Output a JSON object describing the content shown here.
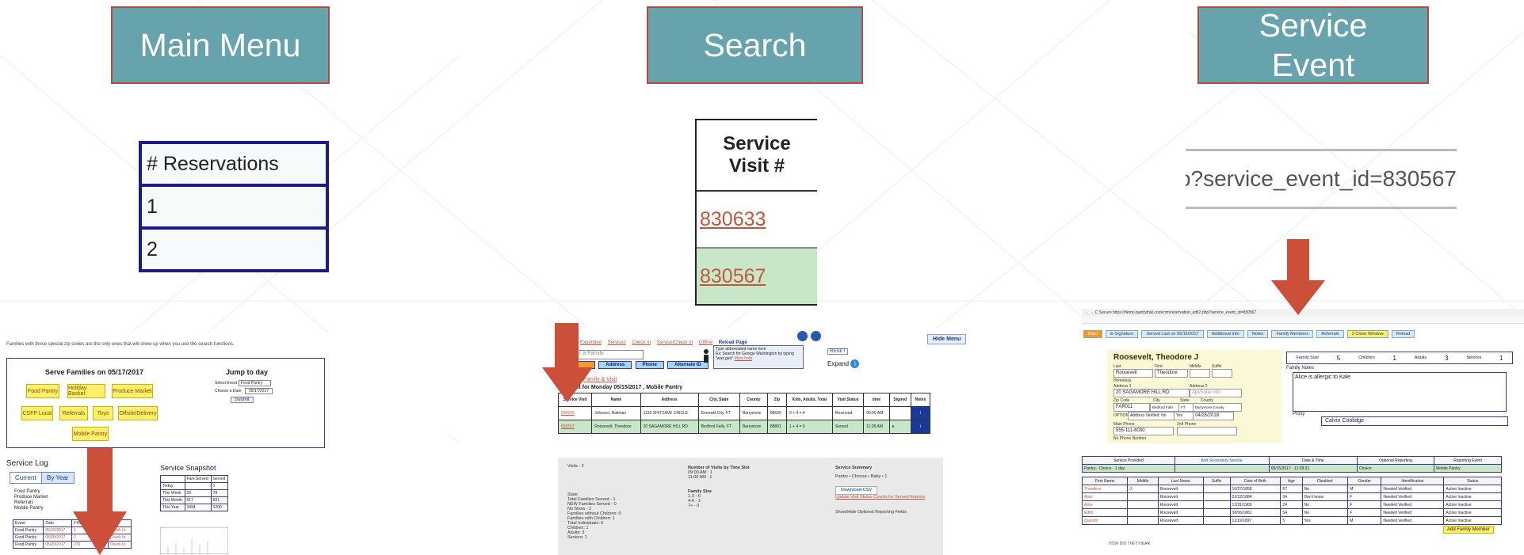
{
  "headers": {
    "main_menu": "Main Menu",
    "search": "Search",
    "service_event": "Service\nEvent"
  },
  "callouts": {
    "reservations": {
      "header": "# Reservations",
      "rows": [
        "1",
        "2"
      ]
    },
    "service_visit": {
      "header": "Service\nVisit #",
      "rows": [
        "830633",
        "830567"
      ]
    },
    "url_fragment": "o?service_event_id=830567"
  },
  "main_menu_screen": {
    "intro_text": "Families with these special zip codes are the only ones that will show up when you use the search functions.",
    "serve_title": "Serve Families on 05/17/2017",
    "jump_title": "Jump to day",
    "select_event_label": "Select Event",
    "select_event_value": "Food Pantry",
    "choose_date_label": "Choose a Date",
    "choose_date_value": "05/17/2017",
    "submit_label": "Submit",
    "event_buttons": [
      "Food Pantry",
      "Holiday Basket",
      "Produce Market",
      "CSFP Local",
      "Referrals",
      "Toys",
      "Offsite/Delivery",
      "Mobile Pantry"
    ],
    "service_log_title": "Service Log",
    "tabs": [
      "Current",
      "By Year"
    ],
    "legend_lines": [
      "Food Pantry",
      "Produce Market",
      "Referrals",
      "Mobile Pantry"
    ],
    "log_headers": [
      "Event",
      "Date",
      "# Reservations",
      ""
    ],
    "log_rows": [
      [
        "Food Pantry",
        "05/20/2017",
        "1",
        "Check In"
      ],
      [
        "Food Pantry",
        "05/20/2017",
        "2",
        "Check In"
      ],
      [
        "Food Pantry",
        "05/20/2017",
        "270",
        "Check In"
      ]
    ],
    "snapshot_title": "Service Snapshot",
    "snapshot_headers": [
      "",
      "Fam Served",
      "Served"
    ],
    "snapshot_rows": [
      [
        "Today",
        "",
        "1"
      ],
      [
        "This Week",
        "29",
        "78"
      ],
      [
        "This Month",
        "617",
        "691"
      ],
      [
        "This Year",
        "3494",
        "1200"
      ]
    ]
  },
  "search_screen": {
    "nav_links": [
      "Expanded",
      "Services",
      "Check In",
      "Service/Check In",
      "Offline"
    ],
    "reload_label": "Reload Page",
    "hide_menu_label": "Hide Menu",
    "search_placeholder": "r a Family",
    "search_tabs": [
      "Address",
      "Phone",
      "Alternate ID"
    ],
    "hint_lines": [
      "Type abbreviated name here",
      "Ex: Search for George Washington by typing",
      "\"was.geo\""
    ],
    "hint_link": "More help",
    "reset_label": "RESET",
    "expand_label": "Expand",
    "section_link": "Family & Visit",
    "visit_title": "Visit list for Monday 05/15/2017 , Mobile Pantry",
    "table_headers": [
      "Service Visit",
      "Name",
      "Address",
      "City, State",
      "County",
      "Zip",
      "Kids, Adults, Total",
      "Visit Status",
      "time",
      "Signed",
      "Notes"
    ],
    "table_rows": [
      [
        "830633",
        "Johnson, Baitman",
        "1130 SHITCAVE CIRCLE",
        "Emerald City, FT",
        "Barrymore",
        "88639",
        "0 + 4 = 4",
        "Reserved",
        "09:00 AM",
        "",
        "i"
      ],
      [
        "830567",
        "Roosevelt, Theodore",
        "20 SAGAMORE HILL RD",
        "Bedford Falls, FT",
        "Barrymore",
        "88801",
        "1 + 4 = 5",
        "Served",
        "11:28 AM",
        "e",
        "i"
      ]
    ],
    "stats_col1": [
      "Visits : 2",
      "",
      "State",
      "Total Families Served - 1",
      "NEW Families Served - 0",
      "No Show - 1",
      "",
      "Families without Children: 0",
      "Families with Children: 1",
      "",
      "Total Individuals: 5",
      "Children: 1",
      "Adults: 3",
      "Seniors: 1"
    ],
    "stats_col2": [
      "Number of Visits by Time Slot",
      "09:00 AM : 1",
      "11:00 AM : 1",
      "",
      "Family Size",
      "1-3 - 0",
      "4-6 - 2",
      "7+ - 0"
    ],
    "stats_col3_title": "Service Summary",
    "stats_col3_line": "Pantry • Choose • Baby • 1",
    "download_label": "Download CSV",
    "stats_col3_link": "Update Visit Status Counts for Served Reports",
    "stats_col3_tail": "Show/Hide Optional Reporting Fields"
  },
  "service_event_screen": {
    "url": "Secure  https://demo.pantrytrak.com/crm/reservation_edit2.php?service_event_id=830567",
    "toolbar": [
      "Main",
      "E-Signature",
      "Served Last on 05/15/2017",
      "Additional Info",
      "Notes",
      "Family Members",
      "Referrals",
      "2 Close Window",
      "Reload"
    ],
    "family_name": "Roosevelt, Theodore J",
    "labels": {
      "last": "Last",
      "first": "First",
      "middle": "Middle",
      "suffix": "Suffix",
      "address1": "Address 1",
      "address2": "Address 2",
      "zip": "Zip Code",
      "city": "City",
      "state": "State",
      "county": "County",
      "main_phone": "Main Phone",
      "second_phone": "2nd Phone",
      "optional": "OPTIONAL",
      "homeless": "Homeless",
      "no_phone": "No Phone Number"
    },
    "fields": {
      "last": "Roosevelt",
      "first": "Theodore",
      "address1": "20 SAGAMORE HILL RD",
      "address2": "Apt/Suite info",
      "zip": "FAR011",
      "city": "Bedford Falls",
      "state": "FT",
      "county": "Barrymore County",
      "address_verified": "Address Verified: No",
      "yes": "Yes",
      "verify_date": "04/25/2018",
      "main_phone": "555-111-6030"
    },
    "counts": {
      "family_size_label": "Family Size",
      "family_size": "5",
      "children_label": "Children",
      "children": "1",
      "adults_label": "Adults",
      "adults": "3",
      "seniors_label": "Seniors",
      "seniors": "1"
    },
    "notes_label": "Family Notes",
    "notes_value": "Alice is allergic to Kale",
    "proxy_label": "Proxy",
    "proxy_value": "Calvin Coolidge",
    "service_headers": [
      "Service Provided",
      "Add Secondary Service",
      "Date & Time",
      "Optional Reporting",
      "Reporting Event"
    ],
    "service_row": [
      "Pantry - Choice - 1 day",
      "",
      "05/15/2017 - 11:28:31",
      "Choice",
      "Mobile Pantry"
    ],
    "member_headers": [
      "First Name",
      "Middle",
      "Last Name",
      "Suffix",
      "Date of Birth",
      "Age",
      "Disabled",
      "Gender",
      "Identification",
      "Status"
    ],
    "members": [
      [
        "Theodore",
        "J",
        "Roosevelt",
        "",
        "10/27/1858",
        "67",
        "No",
        "M",
        "Needed  Verified",
        "Active  Inactive"
      ],
      [
        "Alice",
        "",
        "Roosevelt",
        "",
        "02/12/1884",
        "34",
        "Don't know",
        "F",
        "Needed  Verified",
        "Active  Inactive"
      ],
      [
        "Alice",
        "",
        "Roosevelt",
        "",
        "12/31/1900",
        "24",
        "No",
        "F",
        "Needed  Verified",
        "Active  Inactive"
      ],
      [
        "Edith",
        "",
        "Roosevelt",
        "",
        "08/06/1861",
        "54",
        "No",
        "F",
        "Needed  Verified",
        "Active  Inactive"
      ],
      [
        "Quentin",
        "",
        "Roosevelt",
        "",
        "11/19/1897",
        "5",
        "Yes",
        "M",
        "Needed  Verified",
        "Active  Inactive"
      ]
    ],
    "add_member_label": "Add Family Member",
    "footer_text": "HOW DID THEY HEAR"
  }
}
